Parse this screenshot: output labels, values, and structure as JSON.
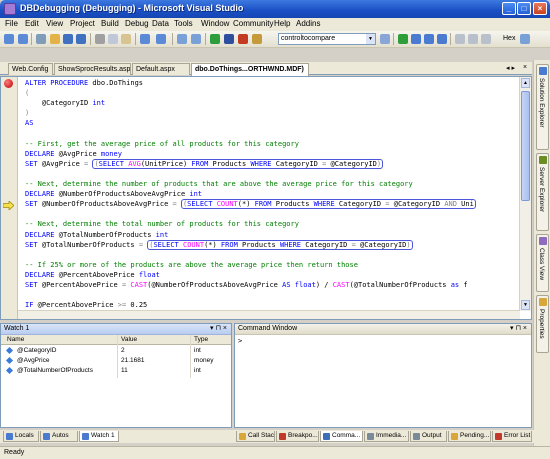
{
  "window": {
    "title": "DBDebugging (Debugging) - Microsoft Visual Studio",
    "controls": {
      "minimize": "_",
      "maximize": "□",
      "close": "×"
    }
  },
  "menu": [
    "File",
    "Edit",
    "View",
    "Project",
    "Build",
    "Debug",
    "Data",
    "Tools",
    "Window",
    "Community",
    "Help",
    "Addins"
  ],
  "toolbar": {
    "find_combo_value": "controltocompare",
    "hex_label": "Hex"
  },
  "doc_tabs": [
    {
      "label": "Web.Config",
      "active": false
    },
    {
      "label": "ShowSprocResults.aspx",
      "active": false
    },
    {
      "label": "Default.aspx",
      "active": false
    },
    {
      "label": "dbo.DoThings...ORTHWND.MDF)",
      "active": true
    }
  ],
  "doc_tab_controls": {
    "nav": "◂ ▸",
    "close": "×"
  },
  "editor": {
    "lines": [
      {
        "parts": [
          {
            "t": "ALTER PROCEDURE",
            "c": "kw"
          },
          {
            "t": " dbo.DoThings"
          }
        ]
      },
      {
        "parts": [
          {
            "t": "(",
            "c": "op"
          }
        ]
      },
      {
        "parts": [
          {
            "t": "    @CategoryID "
          },
          {
            "t": "int",
            "c": "kw"
          }
        ]
      },
      {
        "parts": [
          {
            "t": ")",
            "c": "op"
          }
        ]
      },
      {
        "parts": [
          {
            "t": "AS",
            "c": "kw"
          }
        ]
      },
      {
        "parts": []
      },
      {
        "parts": [
          {
            "t": "-- First, get the average price of all products for this category",
            "c": "cm"
          }
        ]
      },
      {
        "parts": [
          {
            "t": "DECLARE",
            "c": "kw"
          },
          {
            "t": " @AvgPrice "
          },
          {
            "t": "money",
            "c": "kw"
          }
        ]
      },
      {
        "parts": [
          {
            "t": "SET",
            "c": "kw"
          },
          {
            "t": " @AvgPrice "
          },
          {
            "t": "=",
            "c": "op"
          },
          {
            "t": " "
          },
          {
            "t": "(",
            "c": "op",
            "hl": "open"
          },
          {
            "t": "SELECT",
            "c": "kw",
            "hl": "in"
          },
          {
            "t": " ",
            "hl": "in"
          },
          {
            "t": "AVG",
            "c": "fn",
            "hl": "in"
          },
          {
            "t": "(UnitPrice) ",
            "hl": "in"
          },
          {
            "t": "FROM",
            "c": "kw",
            "hl": "in"
          },
          {
            "t": " Products ",
            "hl": "in"
          },
          {
            "t": "WHERE",
            "c": "kw",
            "hl": "in"
          },
          {
            "t": " CategoryID ",
            "hl": "in"
          },
          {
            "t": "=",
            "c": "op",
            "hl": "in"
          },
          {
            "t": " @CategoryID",
            "hl": "in"
          },
          {
            "t": ")",
            "c": "op",
            "hl": "close"
          }
        ]
      },
      {
        "parts": []
      },
      {
        "parts": [
          {
            "t": "-- Next, determine the number of products that are above the average price for this category",
            "c": "cm"
          }
        ]
      },
      {
        "parts": [
          {
            "t": "DECLARE",
            "c": "kw"
          },
          {
            "t": " @NumberOfProductsAboveAvgPrice "
          },
          {
            "t": "int",
            "c": "kw"
          }
        ]
      },
      {
        "parts": [
          {
            "t": "SET",
            "c": "kw"
          },
          {
            "t": " @NumberOfProductsAboveAvgPrice "
          },
          {
            "t": "=",
            "c": "op"
          },
          {
            "t": " "
          },
          {
            "t": "(",
            "c": "op",
            "hl": "open"
          },
          {
            "t": "SELECT",
            "c": "kw",
            "hl": "in"
          },
          {
            "t": " ",
            "hl": "in"
          },
          {
            "t": "COUNT",
            "c": "fn",
            "hl": "in"
          },
          {
            "t": "(*) ",
            "hl": "in"
          },
          {
            "t": "FROM",
            "c": "kw",
            "hl": "in"
          },
          {
            "t": " Products ",
            "hl": "in"
          },
          {
            "t": "WHERE",
            "c": "kw",
            "hl": "in"
          },
          {
            "t": " CategoryID ",
            "hl": "in"
          },
          {
            "t": "=",
            "c": "op",
            "hl": "in"
          },
          {
            "t": " @CategoryID ",
            "hl": "in"
          },
          {
            "t": "AND",
            "c": "op",
            "hl": "in"
          },
          {
            "t": " Uni",
            "hl": "in"
          }
        ]
      },
      {
        "parts": []
      },
      {
        "parts": [
          {
            "t": "-- Next, determine the total number of products for this category",
            "c": "cm"
          }
        ]
      },
      {
        "parts": [
          {
            "t": "DECLARE",
            "c": "kw"
          },
          {
            "t": " @TotalNumberOfProducts "
          },
          {
            "t": "int",
            "c": "kw"
          }
        ]
      },
      {
        "parts": [
          {
            "t": "SET",
            "c": "kw"
          },
          {
            "t": " @TotalNumberOfProducts "
          },
          {
            "t": "=",
            "c": "op"
          },
          {
            "t": " "
          },
          {
            "t": "(",
            "c": "op",
            "hl": "open"
          },
          {
            "t": "SELECT",
            "c": "kw",
            "hl": "in"
          },
          {
            "t": " ",
            "hl": "in"
          },
          {
            "t": "COUNT",
            "c": "fn",
            "hl": "in"
          },
          {
            "t": "(*) ",
            "hl": "in"
          },
          {
            "t": "FROM",
            "c": "kw",
            "hl": "in"
          },
          {
            "t": " Products ",
            "hl": "in"
          },
          {
            "t": "WHERE",
            "c": "kw",
            "hl": "in"
          },
          {
            "t": " CategoryID ",
            "hl": "in"
          },
          {
            "t": "=",
            "c": "op",
            "hl": "in"
          },
          {
            "t": " @CategoryID",
            "hl": "in"
          },
          {
            "t": ")",
            "c": "op",
            "hl": "close"
          }
        ]
      },
      {
        "parts": []
      },
      {
        "parts": [
          {
            "t": "-- If 25% or more of the products are above the average price then return those",
            "c": "cm"
          }
        ]
      },
      {
        "parts": [
          {
            "t": "DECLARE",
            "c": "kw"
          },
          {
            "t": " @PercentAbovePrice "
          },
          {
            "t": "float",
            "c": "kw"
          }
        ]
      },
      {
        "parts": [
          {
            "t": "SET",
            "c": "kw"
          },
          {
            "t": " @PercentAbovePrice "
          },
          {
            "t": "=",
            "c": "op"
          },
          {
            "t": " "
          },
          {
            "t": "CAST",
            "c": "fn"
          },
          {
            "t": "(@NumberOfProductsAboveAvgPrice "
          },
          {
            "t": "AS",
            "c": "kw"
          },
          {
            "t": " "
          },
          {
            "t": "float",
            "c": "kw"
          },
          {
            "t": ") / "
          },
          {
            "t": "CAST",
            "c": "fn"
          },
          {
            "t": "(@TotalNumberOfProducts "
          },
          {
            "t": "as",
            "c": "kw"
          },
          {
            "t": " f"
          }
        ]
      },
      {
        "parts": []
      },
      {
        "parts": [
          {
            "t": "IF",
            "c": "kw"
          },
          {
            "t": " @PercentAbovePrice "
          },
          {
            "t": ">=",
            "c": "op"
          },
          {
            "t": " 0.25"
          }
        ]
      }
    ]
  },
  "watch": {
    "title": "Watch 1",
    "title_controls": "▾ ⊓ ×",
    "columns": [
      "Name",
      "Value",
      "Type"
    ],
    "rows": [
      {
        "name": "@CategoryID",
        "value": "2",
        "type": "int"
      },
      {
        "name": "@AvgPrice",
        "value": "21.1681",
        "type": "money"
      },
      {
        "name": "@TotalNumberOfProducts",
        "value": "11",
        "type": "int"
      }
    ]
  },
  "command_window": {
    "title": "Command Window",
    "title_controls": "▾ ⊓ ×",
    "prompt": ">"
  },
  "bottom_tabs_left": [
    {
      "label": "Locals",
      "active": false,
      "color": "#4a7bd0"
    },
    {
      "label": "Autos",
      "active": false,
      "color": "#4a7bd0"
    },
    {
      "label": "Watch 1",
      "active": true,
      "color": "#4a7bd0"
    }
  ],
  "bottom_tabs_right": [
    {
      "label": "Call Stack",
      "active": false,
      "color": "#d9a63b"
    },
    {
      "label": "Breakpo...",
      "active": false,
      "color": "#c0392b"
    },
    {
      "label": "Comma...",
      "active": true,
      "color": "#3b6fb7"
    },
    {
      "label": "Immedia...",
      "active": false,
      "color": "#7a8a99"
    },
    {
      "label": "Output",
      "active": false,
      "color": "#7a8a99"
    },
    {
      "label": "Pending...",
      "active": false,
      "color": "#d9a63b"
    },
    {
      "label": "Error List",
      "active": false,
      "color": "#c0392b"
    }
  ],
  "right_dock_tabs": [
    {
      "label": "Solution Explorer",
      "icon_color": "#4a7bd0"
    },
    {
      "label": "Server Explorer",
      "icon_color": "#6b8e23"
    },
    {
      "label": "Class View",
      "icon_color": "#8e6bbf"
    },
    {
      "label": "Properties",
      "icon_color": "#d9a63b"
    }
  ],
  "status_bar": {
    "text": "Ready"
  }
}
